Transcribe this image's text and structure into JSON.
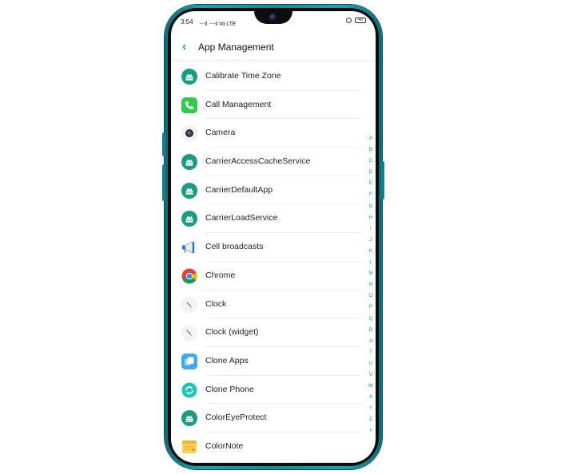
{
  "status_bar": {
    "time": "3:54",
    "signal_text": "᠁ıl ᠁ıl Vo LTE",
    "battery_text": "40"
  },
  "header": {
    "title": "App Management",
    "back_icon": "chevron-left-icon"
  },
  "apps": [
    {
      "label": "Calibrate Time Zone",
      "icon": "android-icon"
    },
    {
      "label": "Call Management",
      "icon": "phone-icon"
    },
    {
      "label": "Camera",
      "icon": "camera-icon"
    },
    {
      "label": "CarrierAccessCacheService",
      "icon": "android-icon"
    },
    {
      "label": "CarrierDefaultApp",
      "icon": "android-icon"
    },
    {
      "label": "CarrierLoadService",
      "icon": "android-icon"
    },
    {
      "label": "Cell broadcasts",
      "icon": "megaphone-icon"
    },
    {
      "label": "Chrome",
      "icon": "chrome-icon"
    },
    {
      "label": "Clock",
      "icon": "clock-icon"
    },
    {
      "label": "Clock (widget)",
      "icon": "clock-icon"
    },
    {
      "label": "Clone Apps",
      "icon": "clone-apps-icon"
    },
    {
      "label": "Clone Phone",
      "icon": "clone-phone-icon"
    },
    {
      "label": "ColorEyeProtect",
      "icon": "android-icon"
    },
    {
      "label": "ColorNote",
      "icon": "colornote-icon"
    }
  ],
  "alphabet_index": [
    "A",
    "B",
    "C",
    "D",
    "E",
    "F",
    "G",
    "H",
    "I",
    "J",
    "K",
    "L",
    "M",
    "N",
    "O",
    "P",
    "Q",
    "R",
    "S",
    "T",
    "U",
    "V",
    "W",
    "X",
    "Y",
    "Z",
    "#"
  ],
  "colors": {
    "accent": "#18a68a",
    "android_icon_bg": "#1a9b82",
    "phone_frame": "#1aa3b3"
  }
}
